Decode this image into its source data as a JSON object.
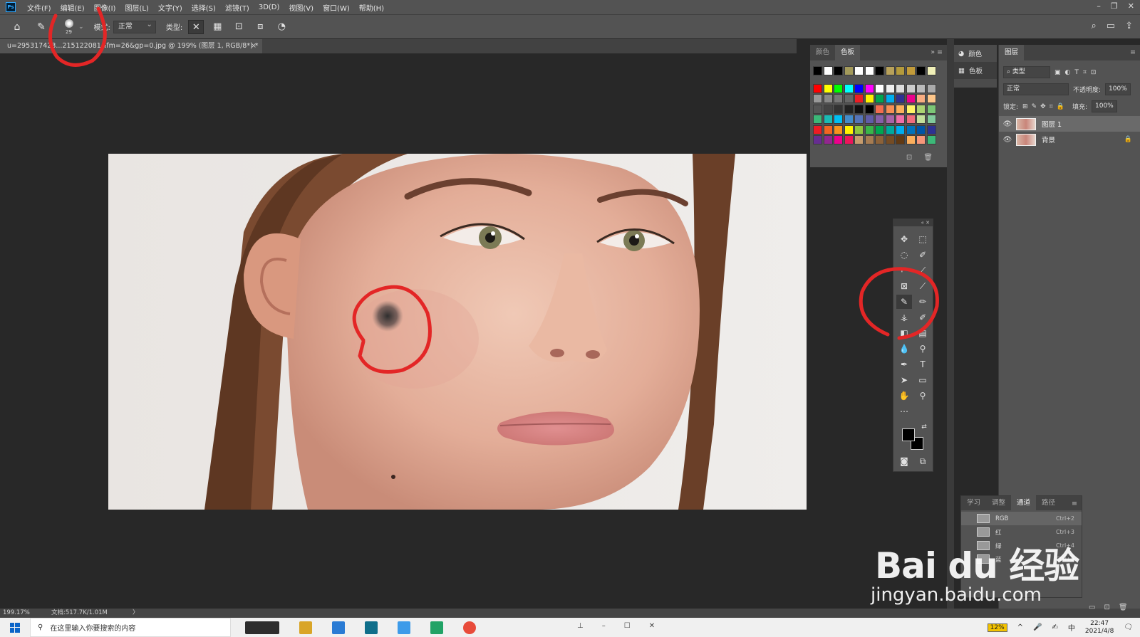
{
  "menubar": {
    "logo": "Ps",
    "items": [
      "文件(F)",
      "编辑(E)",
      "图像(I)",
      "图层(L)",
      "文字(Y)",
      "选择(S)",
      "滤镜(T)",
      "3D(D)",
      "视图(V)",
      "窗口(W)",
      "帮助(H)"
    ],
    "window_controls": [
      "–",
      "❐",
      "✕"
    ]
  },
  "options": {
    "brush_size": "29",
    "mode_label": "模式:",
    "mode_value": "正常",
    "type_label": "类型:"
  },
  "document": {
    "tab_title": "u=295317423...215122081&fm=26&gp=0.jpg @ 199% (图层 1, RGB/8*) *",
    "close": "×"
  },
  "status": {
    "zoom": "199.17%",
    "doc_info": "文档:517.7K/1.01M",
    "arrow": "〉"
  },
  "swatch_panel": {
    "tabs": [
      "颜色",
      "色板"
    ],
    "active_tab": "色板",
    "swatch_rows": [
      [
        "#000000",
        "#ffffff",
        "#000000",
        "#a39a5b",
        "#ffffff",
        "#ffffff",
        "#000000",
        "#b8a15a",
        "#b49a3c",
        "#c29b3a",
        "#000000",
        "#f1f0b8"
      ],
      [
        "#ff0000",
        "#ffff00",
        "#00ff00",
        "#00ffff",
        "#0000ff",
        "#ff00ff",
        "#ffffff",
        "#eeeeee",
        "#dddddd",
        "#cccccc",
        "#bbbbbb",
        "#aaaaaa"
      ],
      [
        "#999999",
        "#888888",
        "#777777",
        "#666666",
        "#ed1c24",
        "#fff200",
        "#00a651",
        "#00aeef",
        "#2e3192",
        "#ec008c",
        "#f9ad81",
        "#fdc68a"
      ],
      [
        "#555555",
        "#444444",
        "#333333",
        "#222222",
        "#111111",
        "#000000",
        "#f26c4f",
        "#f68e55",
        "#fbaf5c",
        "#fff467",
        "#acd372",
        "#7cc576"
      ],
      [
        "#3bb878",
        "#1abbb4",
        "#00bff3",
        "#438cca",
        "#5574b9",
        "#605ca8",
        "#855fa8",
        "#a763a8",
        "#f06ea9",
        "#f26d7d",
        "#c4df9b",
        "#82ca9c"
      ],
      [
        "#ed1c24",
        "#f26522",
        "#f7941d",
        "#fff200",
        "#8dc63f",
        "#39b54a",
        "#00a651",
        "#00a99d",
        "#00aeef",
        "#0072bc",
        "#0054a6",
        "#2e3192"
      ],
      [
        "#662d91",
        "#92278f",
        "#ec008c",
        "#ed145b",
        "#c69c6d",
        "#a67c52",
        "#8c6239",
        "#754c24",
        "#603913",
        "#fbaf5d",
        "#f7977a",
        "#3cb878"
      ]
    ]
  },
  "collapsed_dock": {
    "items": [
      "颜色",
      "色板"
    ]
  },
  "layers_panel": {
    "tab": "图层",
    "filter_label": "类型",
    "blend_mode": "正常",
    "opacity_label": "不透明度:",
    "opacity_value": "100%",
    "lock_label": "锁定:",
    "fill_label": "填充:",
    "fill_value": "100%",
    "layers": [
      {
        "name": "图层 1",
        "selected": true
      },
      {
        "name": "背景",
        "selected": false
      }
    ]
  },
  "channels_panel": {
    "tabs": [
      "学习",
      "调整",
      "通道",
      "路径"
    ],
    "active_tab": "通道",
    "channels": [
      {
        "name": "RGB",
        "shortcut": "Ctrl+2"
      },
      {
        "name": "红",
        "shortcut": "Ctrl+3"
      },
      {
        "name": "绿",
        "shortcut": "Ctrl+4"
      },
      {
        "name": "蓝",
        "shortcut": "Ctrl+5"
      }
    ]
  },
  "taskbar": {
    "search_placeholder": "在这里输入你要搜索的内容",
    "battery": "12%",
    "ime": "中",
    "time": "22:47",
    "date": "2021/4/8"
  },
  "watermark": {
    "brand": "Bai du 经验",
    "url": "jingyan.baidu.com"
  },
  "colors": {
    "annotation_red": "#e32626",
    "panel_bg": "#535353",
    "workspace_bg": "#282828"
  }
}
